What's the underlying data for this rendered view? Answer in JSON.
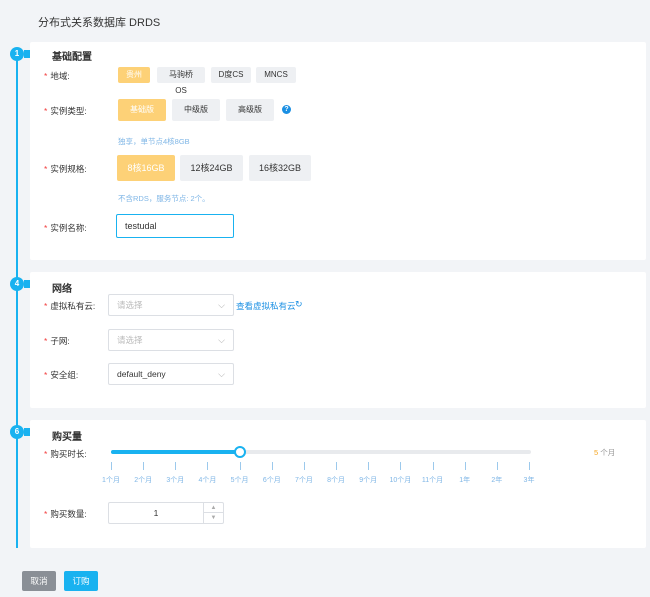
{
  "page": {
    "title": "分布式关系数据库 DRDS"
  },
  "sections": {
    "basic": {
      "step": "1",
      "title": "基础配置"
    },
    "network": {
      "step": "4",
      "title": "网络"
    },
    "purchase": {
      "step": "6",
      "title": "购买量"
    }
  },
  "basic": {
    "region": {
      "label": "地域:",
      "options": [
        "贵州",
        "马驹桥OS",
        "D度CS",
        "MNCS"
      ],
      "selected": "贵州"
    },
    "instance_type": {
      "label": "实例类型:",
      "options": [
        "基础版",
        "中级版",
        "高级版"
      ],
      "selected": "基础版",
      "hint": "独享，单节点4核8GB"
    },
    "instance_spec": {
      "label": "实例规格:",
      "options": [
        "8核16GB",
        "12核24GB",
        "16核32GB"
      ],
      "selected": "8核16GB",
      "hint": "不含RDS，服务节点: 2个。"
    },
    "instance_name": {
      "label": "实例名称:",
      "value": "testudal"
    }
  },
  "network": {
    "vpc": {
      "label": "虚拟私有云:",
      "placeholder": "请选择",
      "link": "查看虚拟私有云"
    },
    "subnet": {
      "label": "子网:",
      "placeholder": "请选择"
    },
    "security_group": {
      "label": "安全组:",
      "value": "default_deny"
    }
  },
  "purchase": {
    "duration": {
      "label": "购买时长:",
      "ticks": [
        "1个月",
        "2个月",
        "3个月",
        "4个月",
        "5个月",
        "6个月",
        "7个月",
        "8个月",
        "9个月",
        "10个月",
        "11个月",
        "1年",
        "2年",
        "3年"
      ],
      "selected_index": 4,
      "value": "5",
      "unit": "个月"
    },
    "quantity": {
      "label": "购买数量:",
      "value": "1"
    }
  },
  "footer": {
    "cancel_label": "取消",
    "order_label": "订购"
  },
  "colors": {
    "accent": "#19b2f0",
    "selected": "#fdd177",
    "required": "#f23c3c",
    "link": "#1a8fe3"
  }
}
